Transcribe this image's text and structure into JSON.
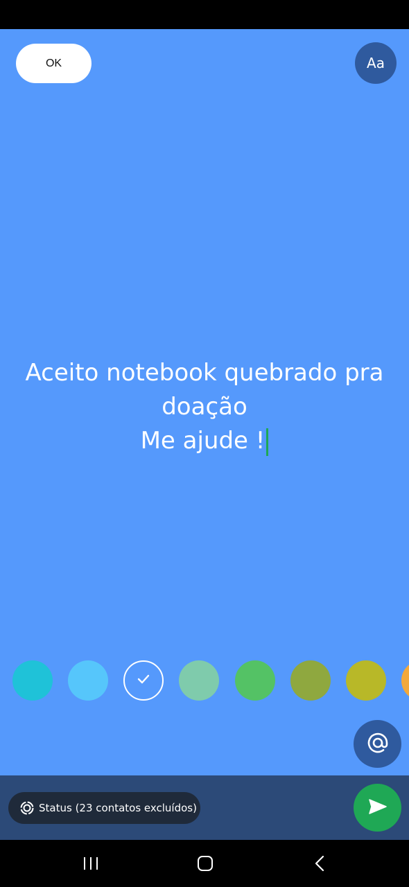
{
  "editor": {
    "ok_label": "OK",
    "font_label": "Aa",
    "background_color": "#5599fc",
    "text_lines": [
      "Aceito notebook quebrado pra",
      "doação",
      "Me ajude !"
    ]
  },
  "color_swatches": [
    {
      "color": "#1fc2d8",
      "selected": false
    },
    {
      "color": "#56c6fb",
      "selected": false
    },
    {
      "color": "#5599fc",
      "selected": true
    },
    {
      "color": "#7fcbac",
      "selected": false
    },
    {
      "color": "#54c265",
      "selected": false
    },
    {
      "color": "#8fa83f",
      "selected": false
    },
    {
      "color": "#b8b828",
      "selected": false
    },
    {
      "color": "#f2a83b",
      "selected": false
    }
  ],
  "icons": {
    "mention": "at-icon",
    "audience": "status-ring-icon",
    "send": "send-icon",
    "check": "check-icon"
  },
  "bottom_bar": {
    "audience_label": "Status (23 contatos excluídos)"
  },
  "accent_colors": {
    "send": "#1fa855",
    "dark_button": "#2f5a9e",
    "bar": "#2c4a78"
  }
}
